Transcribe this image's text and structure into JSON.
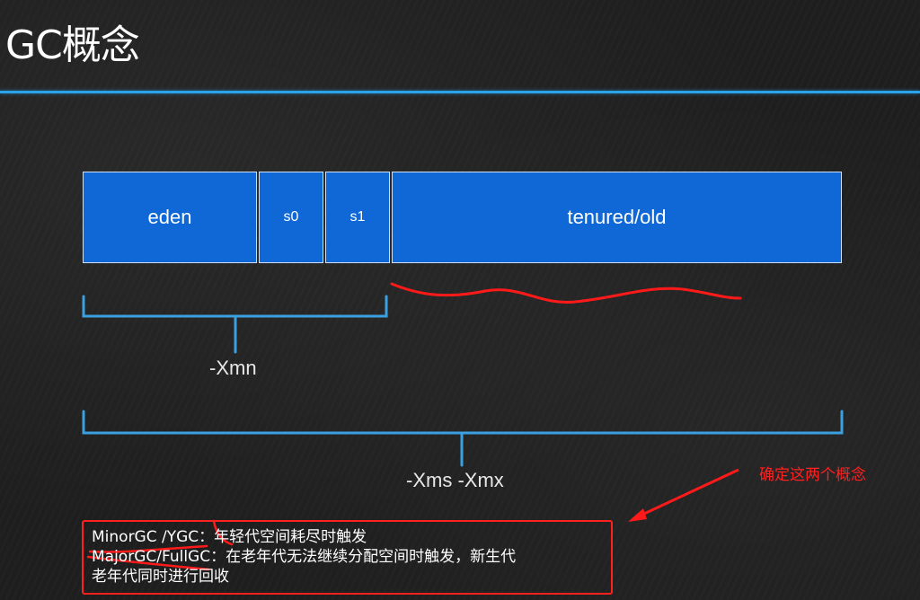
{
  "title": "GC概念",
  "heap": {
    "eden": "eden",
    "s0": "s0",
    "s1": "s1",
    "tenured": "tenured/old"
  },
  "brackets": {
    "young": "-Xmn",
    "whole": "-Xms -Xmx"
  },
  "annotation": "确定这两个概念",
  "gc_definitions": {
    "line1": "MinorGC /YGC：年轻代空间耗尽时触发",
    "line2": "MajorGC/FullGC：在老年代无法继续分配空间时触发，新生代",
    "line3": "老年代同时进行回收"
  },
  "colors": {
    "background": "#1e1e1e",
    "heap_fill": "#0f68d6",
    "bracket": "#3aa0e0",
    "accent_red": "#ff2020",
    "rule": "#2aa3e8"
  }
}
